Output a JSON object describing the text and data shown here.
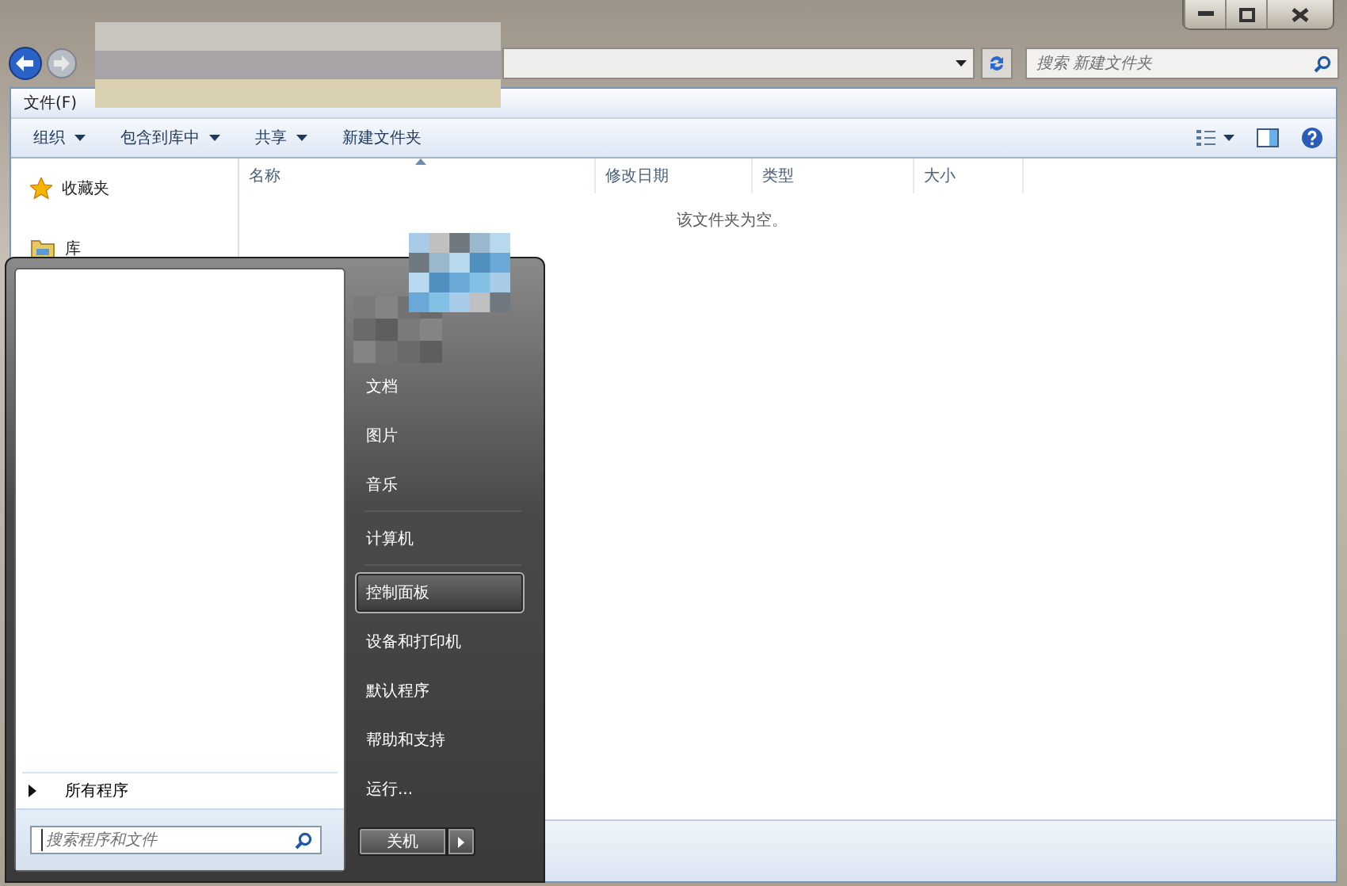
{
  "search": {
    "placeholder": "搜索 新建文件夹"
  },
  "menu_bar": [
    "文件(F)"
  ],
  "toolbar": [
    {
      "label": "组织",
      "dropdown": true
    },
    {
      "label": "包含到库中",
      "dropdown": true
    },
    {
      "label": "共享",
      "dropdown": true
    },
    {
      "label": "新建文件夹",
      "dropdown": false
    }
  ],
  "navigation": [
    {
      "label": "收藏夹",
      "kind": "favorites"
    },
    {
      "label": "库",
      "kind": "library"
    }
  ],
  "columns": [
    {
      "label": "名称",
      "sorted": true
    },
    {
      "label": "修改日期",
      "sorted": false
    },
    {
      "label": "类型",
      "sorted": false
    },
    {
      "label": "大小",
      "sorted": false
    }
  ],
  "empty_message": "该文件夹为空。",
  "start_menu": {
    "all_programs": "所有程序",
    "search_placeholder": "搜索程序和文件",
    "shutdown": "关机",
    "items": [
      {
        "label": "文档",
        "selected": false,
        "separator_after": false
      },
      {
        "label": "图片",
        "selected": false,
        "separator_after": false
      },
      {
        "label": "音乐",
        "selected": false,
        "separator_after": true
      },
      {
        "label": "计算机",
        "selected": false,
        "separator_after": true
      },
      {
        "label": "控制面板",
        "selected": true,
        "separator_after": false
      },
      {
        "label": "设备和打印机",
        "selected": false,
        "separator_after": false
      },
      {
        "label": "默认程序",
        "selected": false,
        "separator_after": false
      },
      {
        "label": "帮助和支持",
        "selected": false,
        "separator_after": false
      },
      {
        "label": "运行...",
        "selected": false,
        "separator_after": false
      }
    ]
  }
}
